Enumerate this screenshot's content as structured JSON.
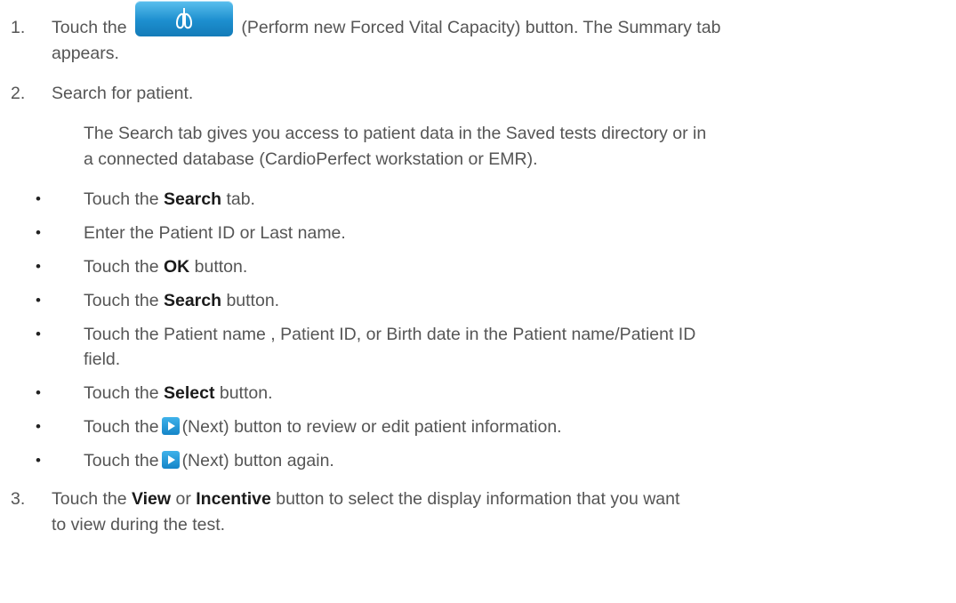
{
  "step1": {
    "number": "1.",
    "pre": "Touch the",
    "post": "(Perform new Forced Vital Capacity) button. The Summary tab",
    "cont": "appears.",
    "button_icon": "lungs-icon"
  },
  "step2": {
    "number": "2.",
    "text": "Search for patient.",
    "para_line1": "The Search tab gives you access to patient data in the Saved tests directory or in",
    "para_line2": "a connected database (CardioPerfect workstation or EMR).",
    "bullet_char": "•",
    "b1": {
      "pre": "Touch the ",
      "bold": "Search",
      "post": " tab."
    },
    "b2": {
      "text": "Enter the Patient ID or Last name."
    },
    "b3": {
      "pre": "Touch the ",
      "bold": "OK",
      "post": " button."
    },
    "b4": {
      "pre": "Touch the ",
      "bold": "Search",
      "post": " button."
    },
    "b5": {
      "line1": "Touch the Patient name , Patient ID, or Birth date in the Patient name/Patient ID",
      "line2": "field."
    },
    "b6": {
      "pre": "Touch the ",
      "bold": "Select",
      "post": " button."
    },
    "b7": {
      "pre": "Touch the",
      "post": "(Next) button to review or edit patient information."
    },
    "b8": {
      "pre": "Touch the",
      "post": "(Next) button again."
    }
  },
  "step3": {
    "number": "3.",
    "pre": "Touch the ",
    "bold1": "View",
    "mid": " or ",
    "bold2": "Incentive",
    "post": " button to select the display information that you want",
    "cont": "to view during the test."
  }
}
